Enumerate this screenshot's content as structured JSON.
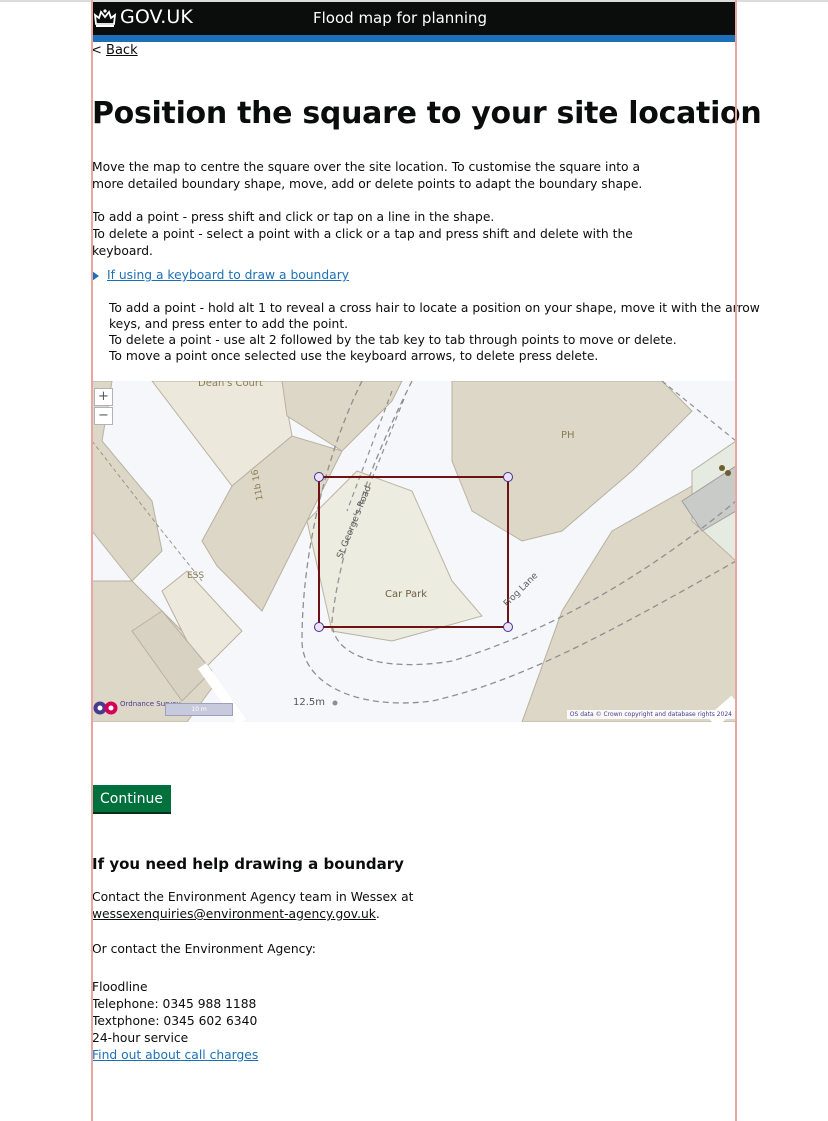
{
  "header": {
    "brand": "GOV.UK",
    "service_name": "Flood map for planning"
  },
  "nav": {
    "back_label": "Back",
    "back_chevron": "<"
  },
  "page": {
    "title": "Position the square to your site location",
    "intro": "Move the map to centre the square over the site location. To customise the square into a more detailed boundary shape, move, add or delete points to adapt the boundary shape.",
    "add_point": "To add a point - press shift and click or tap on a line in the shape.",
    "delete_point": "To delete a point - select a point with a click or a tap and press shift and delete with the keyboard."
  },
  "keyboard_help": {
    "summary": "If using a keyboard to draw a boundary",
    "line1": "To add a point - hold alt 1 to reveal a cross hair to locate a position on your shape, move it with the arrow keys, and press enter to add the point.",
    "line2": "To delete a point - use alt 2 followed by the tab key to tab through points to move or delete.",
    "line3": "To move a point once selected use the keyboard arrows, to delete press delete."
  },
  "map": {
    "zoom_in": "+",
    "zoom_out": "−",
    "labels": {
      "deans_court": "Dean's Court",
      "ph": "PH",
      "house_number": "11b 16",
      "street_1": "St George's Road",
      "car_park": "Car Park",
      "street_2": "Frog Lane",
      "ess": "ESS"
    },
    "os_brand": "Ordnance Survey",
    "scale_bar": "10 m",
    "scale_label": "12.5m",
    "copyright": "OS data © Crown copyright and database rights 2024",
    "boundary_color": "#6e1212",
    "vertex_color": "#4c2c92"
  },
  "actions": {
    "continue_label": "Continue"
  },
  "help": {
    "heading": "If you need help drawing a boundary",
    "contact_text": "Contact the Environment Agency team in Wessex at",
    "email": "wessexenquiries@environment-agency.gov.uk",
    "email_suffix": ".",
    "or_contact": "Or contact the Environment Agency:",
    "floodline": "Floodline",
    "telephone": "Telephone: 0345 988 1188",
    "textphone": "Textphone: 0345 602 6340",
    "hours": "24-hour service",
    "call_charges_link": "Find out about call charges"
  },
  "colors": {
    "header_bg": "#0b0c0c",
    "header_accent": "#1d70b8",
    "link": "#1d70b8",
    "button": "#00703c"
  }
}
